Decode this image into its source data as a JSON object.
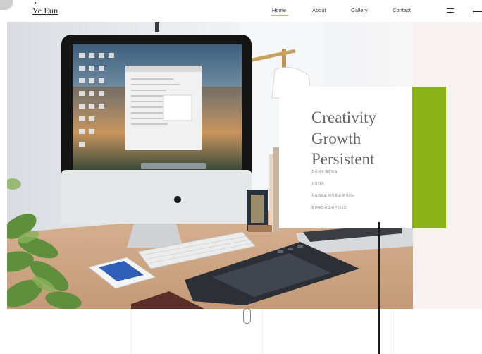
{
  "header": {
    "logo": "Ye Eun",
    "nav": [
      {
        "label": "Home",
        "active": true
      },
      {
        "label": "About",
        "active": false
      },
      {
        "label": "Gallery",
        "active": false
      },
      {
        "label": "Contact",
        "active": false
      }
    ],
    "menu_icon": "hamburger-icon"
  },
  "hero": {
    "image": "desk-workspace-photo",
    "headline": [
      "Creativity",
      "Growth",
      "Persistent"
    ],
    "body_lines": [
      "창의성이 재밌어요,",
      "성장하며,",
      "지속적으로 제가 믿음 끝까지는",
      "웹퍼블리셔 고예은입니다"
    ],
    "accent_color": "#8cb315"
  },
  "scroll_indicator": "mouse-scroll-icon"
}
